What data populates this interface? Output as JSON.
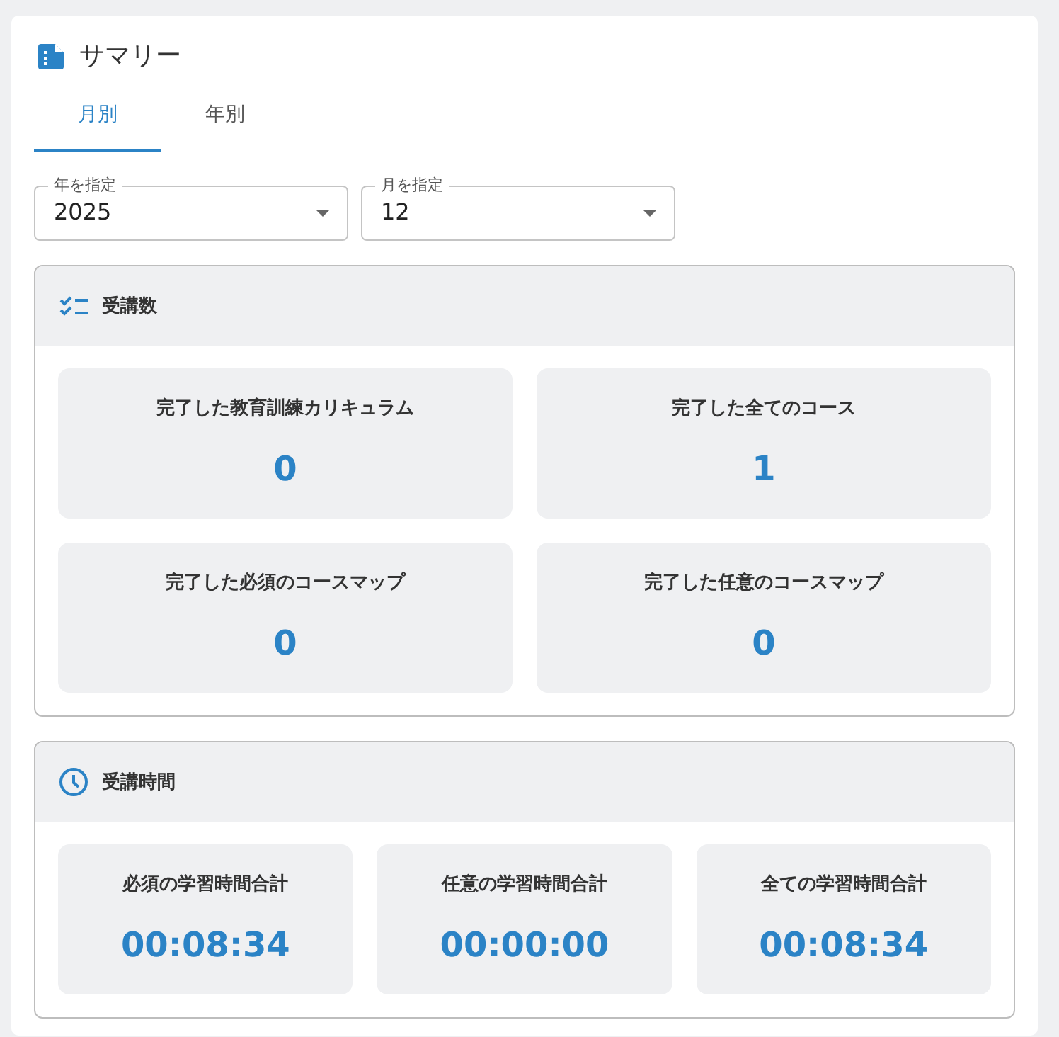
{
  "header": {
    "title": "サマリー"
  },
  "tabs": [
    {
      "label": "月別",
      "selected": true
    },
    {
      "label": "年別",
      "selected": false
    }
  ],
  "filters": [
    {
      "label": "年を指定",
      "value": "2025"
    },
    {
      "label": "月を指定",
      "value": "12"
    }
  ],
  "sections": [
    {
      "kind": "counts",
      "title": "受講数",
      "stats": [
        {
          "label": "完了した教育訓練カリキュラム",
          "value": "0"
        },
        {
          "label": "完了した全てのコース",
          "value": "1"
        },
        {
          "label": "完了した必須のコースマップ",
          "value": "0"
        },
        {
          "label": "完了した任意のコースマップ",
          "value": "0"
        }
      ]
    },
    {
      "kind": "time",
      "title": "受講時間",
      "stats": [
        {
          "label": "必須の学習時間合計",
          "value": "00:08:34"
        },
        {
          "label": "任意の学習時間合計",
          "value": "00:00:00"
        },
        {
          "label": "全ての学習時間合計",
          "value": "00:08:34"
        }
      ]
    }
  ]
}
